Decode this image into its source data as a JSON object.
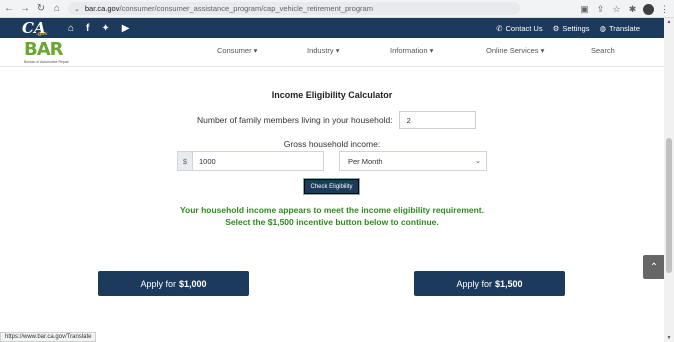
{
  "browser": {
    "url_host": "bar.ca.gov",
    "url_path": "/consumer/consumer_assistance_program/cap_vehicle_retirement_program"
  },
  "top_header": {
    "logo_text": "CA",
    "logo_sub": ".gov",
    "contact_label": "Contact Us",
    "settings_label": "Settings",
    "translate_label": "Translate"
  },
  "main_nav": {
    "logo_letters": "BAR",
    "logo_sub": "Bureau of Automotive Repair",
    "items": [
      {
        "label": "Consumer ▾"
      },
      {
        "label": "Industry ▾"
      },
      {
        "label": "Information ▾"
      },
      {
        "label": "Online Services ▾"
      },
      {
        "label": "Search"
      }
    ]
  },
  "calculator": {
    "title": "Income Eligibility Calculator",
    "family_label": "Number of family members living in your household:",
    "family_value": "2",
    "gross_label": "Gross household income:",
    "currency_symbol": "$",
    "income_value": "1000",
    "period_selected": "Per Month",
    "check_button": "Check Eligibility",
    "result_line1": "Your household income appears to meet the income eligibility requirement.",
    "result_line2": "Select the $1,500 incentive button below to continue."
  },
  "apply_buttons": {
    "prefix": "Apply for",
    "amount_1000": "$1,000",
    "amount_1500": "$1,500"
  },
  "status_bar": {
    "text": "https://www.bar.ca.gov/Translate"
  }
}
